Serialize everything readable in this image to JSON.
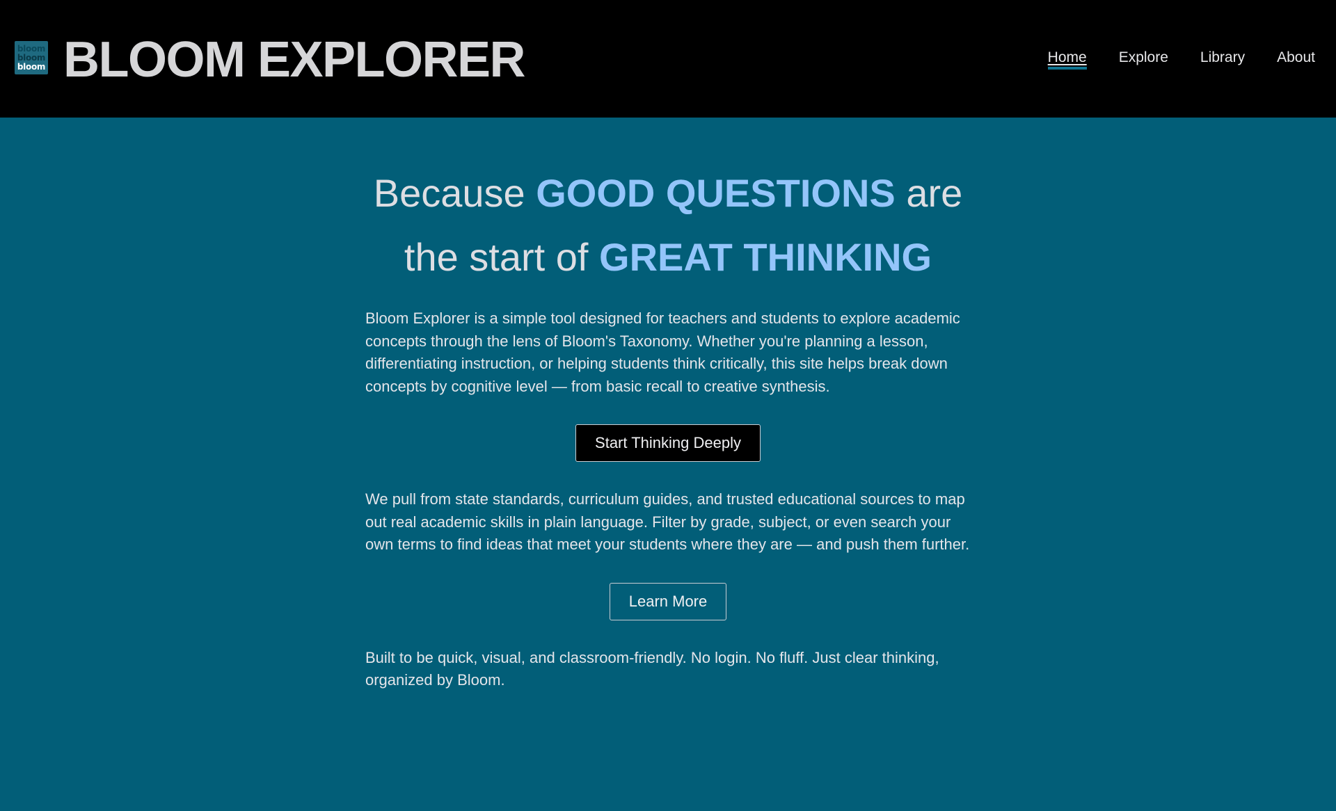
{
  "header": {
    "logo_lines": [
      "bloom",
      "bloom",
      "bloom"
    ],
    "title": "BLOOM EXPLORER",
    "nav": [
      {
        "label": "Home",
        "active": true
      },
      {
        "label": "Explore",
        "active": false
      },
      {
        "label": "Library",
        "active": false
      },
      {
        "label": "About",
        "active": false
      }
    ]
  },
  "hero": {
    "line1_pre": "Because",
    "line1_highlight": "GOOD QUESTIONS",
    "line1_post": "are",
    "line2_pre": "the start of",
    "line2_highlight": "GREAT THINKING"
  },
  "main": {
    "intro": "Bloom Explorer is a simple tool designed for teachers and students to explore academic concepts through the lens of Bloom's Taxonomy. Whether you're planning a lesson, differentiating instruction, or helping students think critically, this site helps break down concepts by cognitive level — from basic recall to creative synthesis.",
    "primary_button": "Start Thinking Deeply",
    "sources": "We pull from state standards, curriculum guides, and trusted educational sources to map out real academic skills in plain language. Filter by grade, subject, or even search your own terms to find ideas that meet your students where they are — and push them further.",
    "secondary_button": "Learn More",
    "footer_note": "Built to be quick, visual, and classroom-friendly. No login. No fluff. Just clear thinking, organized by Bloom."
  },
  "colors": {
    "header_bg": "#000000",
    "page_bg": "#025e78",
    "highlight": "#94c5fa",
    "nav_active_underline": "#0f7592"
  },
  "icons": {
    "logo": "bloom-logo-icon"
  }
}
